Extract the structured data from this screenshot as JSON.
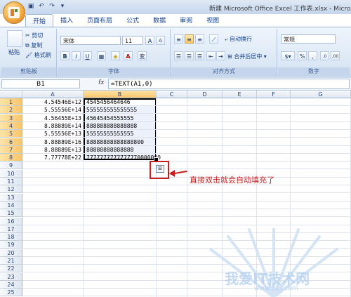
{
  "window": {
    "title": "新建 Microsoft Office Excel 工作表.xlsx - Micros"
  },
  "ribbon": {
    "tabs": [
      "开始",
      "插入",
      "页面布局",
      "公式",
      "数据",
      "审阅",
      "视图"
    ],
    "active_tab": "开始",
    "clipboard": {
      "paste": "粘贴",
      "cut": "剪切",
      "copy": "复制",
      "format_painter": "格式刷",
      "group_label": "剪贴板"
    },
    "font": {
      "name": "宋体",
      "size": "11",
      "grow": "A",
      "shrink": "A",
      "bold": "B",
      "italic": "I",
      "underline": "U",
      "group_label": "字体"
    },
    "alignment": {
      "wrap_text": "自动换行",
      "merge_center": "合并后居中",
      "group_label": "对齐方式"
    },
    "number": {
      "format": "常规",
      "percent": "%",
      "comma": ",",
      "group_label": "数字"
    }
  },
  "formula_bar": {
    "name_box": "B1",
    "fx": "fx",
    "formula": "=TEXT(A1,0)"
  },
  "sheet": {
    "columns": [
      "A",
      "B",
      "C",
      "D",
      "E",
      "F",
      "G"
    ],
    "rows": [
      "1",
      "2",
      "3",
      "4",
      "5",
      "6",
      "7",
      "8",
      "9",
      "10",
      "11",
      "12",
      "13",
      "14",
      "15",
      "16",
      "17",
      "18",
      "19",
      "20",
      "21",
      "22",
      "23",
      "24",
      "25"
    ],
    "selected_column": "B",
    "selected_rows": [
      "1",
      "2",
      "3",
      "4",
      "5",
      "6",
      "7",
      "8"
    ],
    "data": [
      {
        "a": "4.54546E+12",
        "b": "4545456464646"
      },
      {
        "a": "5.55556E+14",
        "b": "555555555555555"
      },
      {
        "a": "4.56455E+13",
        "b": "45645454555555"
      },
      {
        "a": "8.88889E+14",
        "b": "888888888888888"
      },
      {
        "a": "5.55556E+13",
        "b": "55555555555555"
      },
      {
        "a": "8.88889E+16",
        "b": "88888888888888800"
      },
      {
        "a": "8.88889E+13",
        "b": "88888888888888"
      },
      {
        "a": "7.77778E+22",
        "b": "7777777777777770000000"
      }
    ]
  },
  "annotation": {
    "note": "直接双击就会自动填充了",
    "color": "#c71e1e"
  },
  "watermark": {
    "text": "我爱IT技术网",
    "url": "www.52ij.com"
  },
  "colors": {
    "ribbon": "#dbe7f5",
    "selection_header": "#f8c56a",
    "accent": "#15428b"
  }
}
